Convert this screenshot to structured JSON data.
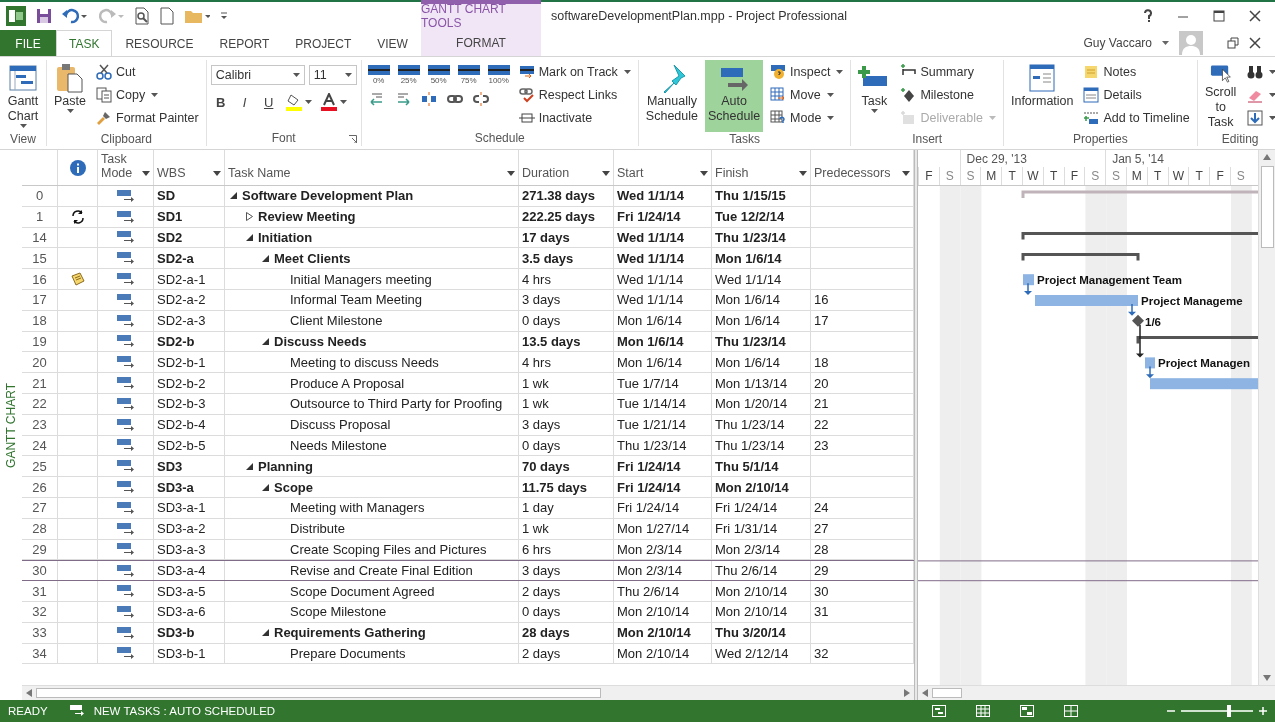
{
  "window": {
    "title": "softwareDevelopmentPlan.mpp - Project Professional",
    "context_group": "GANTT CHART TOOLS",
    "user": "Guy Vaccaro"
  },
  "ribbon_tabs": [
    {
      "label": "FILE",
      "kind": "file",
      "selected": false
    },
    {
      "label": "TASK",
      "kind": "tab",
      "selected": true
    },
    {
      "label": "RESOURCE",
      "kind": "tab",
      "selected": false
    },
    {
      "label": "REPORT",
      "kind": "tab",
      "selected": false
    },
    {
      "label": "PROJECT",
      "kind": "tab",
      "selected": false
    },
    {
      "label": "VIEW",
      "kind": "tab",
      "selected": false
    },
    {
      "label": "FORMAT",
      "kind": "context",
      "selected": false
    }
  ],
  "ribbon_groups": [
    {
      "label": "View",
      "items": [
        {
          "kind": "large",
          "label": "Gantt\nChart",
          "dropdown": true
        }
      ]
    },
    {
      "label": "Clipboard",
      "items": [
        {
          "kind": "large",
          "label": "Paste",
          "dropdown": true
        },
        {
          "kind": "small",
          "label": "Cut"
        },
        {
          "kind": "small",
          "label": "Copy",
          "dropdown": true
        },
        {
          "kind": "small",
          "label": "Format Painter"
        }
      ]
    },
    {
      "label": "Font",
      "launcher": true,
      "items": [
        {
          "kind": "font_face",
          "value": "Calibri"
        },
        {
          "kind": "font_size",
          "value": "11"
        },
        {
          "kind": "format",
          "label": "B"
        },
        {
          "kind": "format",
          "label": "I"
        },
        {
          "kind": "format",
          "label": "U"
        },
        {
          "kind": "color",
          "color": "#ffff00"
        },
        {
          "kind": "color",
          "color": "#e81123"
        }
      ]
    },
    {
      "label": "Schedule",
      "items": [
        {
          "kind": "percent",
          "label": "0%"
        },
        {
          "kind": "percent",
          "label": "25%"
        },
        {
          "kind": "percent",
          "label": "50%"
        },
        {
          "kind": "percent",
          "label": "75%"
        },
        {
          "kind": "percent",
          "label": "100%"
        },
        {
          "kind": "tool"
        },
        {
          "kind": "tool"
        },
        {
          "kind": "tool"
        },
        {
          "kind": "tool"
        },
        {
          "kind": "tool"
        },
        {
          "kind": "small",
          "label": "Mark on Track",
          "dropdown": true
        },
        {
          "kind": "small",
          "label": "Respect Links"
        },
        {
          "kind": "small",
          "label": "Inactivate"
        }
      ]
    },
    {
      "label": "Tasks",
      "items": [
        {
          "kind": "large",
          "label": "Manually\nSchedule",
          "selected": false
        },
        {
          "kind": "large",
          "label": "Auto\nSchedule",
          "selected": true
        },
        {
          "kind": "small",
          "label": "Inspect",
          "dropdown": true
        },
        {
          "kind": "small",
          "label": "Move",
          "dropdown": true
        },
        {
          "kind": "small",
          "label": "Mode",
          "dropdown": true
        }
      ]
    },
    {
      "label": "Insert",
      "items": [
        {
          "kind": "large",
          "label": "Task",
          "dropdown": true
        },
        {
          "kind": "small",
          "label": "Summary"
        },
        {
          "kind": "small",
          "label": "Milestone"
        },
        {
          "kind": "small",
          "label": "Deliverable",
          "dropdown": true,
          "disabled": true
        }
      ]
    },
    {
      "label": "Properties",
      "items": [
        {
          "kind": "large",
          "label": "Information"
        },
        {
          "kind": "small",
          "label": "Notes"
        },
        {
          "kind": "small",
          "label": "Details"
        },
        {
          "kind": "small",
          "label": "Add to Timeline"
        }
      ]
    },
    {
      "label": "Editing",
      "items": [
        {
          "kind": "large",
          "label": "Scroll\nto Task"
        },
        {
          "kind": "small",
          "dropdown": true
        },
        {
          "kind": "small",
          "dropdown": true
        },
        {
          "kind": "small",
          "dropdown": true
        }
      ]
    }
  ],
  "view_label": "GANTT CHART",
  "columns": [
    {
      "label": "Task\nMode",
      "filter": true
    },
    {
      "label": "WBS",
      "filter": true
    },
    {
      "label": "Task Name",
      "filter": true
    },
    {
      "label": "Duration",
      "filter": true
    },
    {
      "label": "Start",
      "filter": true
    },
    {
      "label": "Finish",
      "filter": true
    },
    {
      "label": "Predecessors",
      "filter": true
    }
  ],
  "tasks": [
    {
      "row_number": "0",
      "wbs": "SD",
      "name": "Software Development Plan",
      "duration": "271.38 days",
      "start": "Wed 1/1/14",
      "finish": "Thu 1/15/15",
      "kind": "summary",
      "expanded": true,
      "selected": false,
      "children": [
        {
          "row_number": "1",
          "recurring": true,
          "wbs": "SD1",
          "name": "Review Meeting",
          "duration": "222.25 days",
          "start": "Fri 1/24/14",
          "finish": "Tue 12/2/14",
          "kind": "summary",
          "expanded": false,
          "selected": false
        },
        {
          "row_number": "14",
          "wbs": "SD2",
          "name": "Initiation",
          "duration": "17 days",
          "start": "Wed 1/1/14",
          "finish": "Thu 1/23/14",
          "kind": "summary",
          "expanded": true,
          "selected": false,
          "children": [
            {
              "row_number": "15",
              "wbs": "SD2-a",
              "name": "Meet Clients",
              "duration": "3.5 days",
              "start": "Wed 1/1/14",
              "finish": "Mon 1/6/14",
              "kind": "summary",
              "expanded": true,
              "selected": false,
              "children": [
                {
                  "row_number": "16",
                  "has_note": true,
                  "wbs": "SD2-a-1",
                  "name": "Initial Managers meeting",
                  "duration": "4 hrs",
                  "start": "Wed 1/1/14",
                  "finish": "Wed 1/1/14",
                  "kind": "task",
                  "selected": false,
                  "bar_label": "Project Management Team"
                },
                {
                  "row_number": "17",
                  "wbs": "SD2-a-2",
                  "name": "Informal Team Meeting",
                  "duration": "3 days",
                  "start": "Wed 1/1/14",
                  "finish": "Mon 1/6/14",
                  "predecessors": "16",
                  "kind": "task",
                  "selected": false,
                  "bar_label": "Project Manageme"
                },
                {
                  "row_number": "18",
                  "wbs": "SD2-a-3",
                  "name": "Client Milestone",
                  "duration": "0 days",
                  "start": "Mon 1/6/14",
                  "finish": "Mon 1/6/14",
                  "predecessors": "17",
                  "kind": "milestone",
                  "selected": false,
                  "bar_label": "1/6"
                }
              ]
            },
            {
              "row_number": "19",
              "wbs": "SD2-b",
              "name": "Discuss Needs",
              "duration": "13.5 days",
              "start": "Mon 1/6/14",
              "finish": "Thu 1/23/14",
              "kind": "summary",
              "expanded": true,
              "selected": false,
              "children": [
                {
                  "row_number": "20",
                  "wbs": "SD2-b-1",
                  "name": "Meeting to discuss Needs",
                  "duration": "4 hrs",
                  "start": "Mon 1/6/14",
                  "finish": "Mon 1/6/14",
                  "predecessors": "18",
                  "kind": "task",
                  "selected": false,
                  "bar_label": "Project Managen"
                },
                {
                  "row_number": "21",
                  "wbs": "SD2-b-2",
                  "name": "Produce A Proposal",
                  "duration": "1 wk",
                  "start": "Tue 1/7/14",
                  "finish": "Mon 1/13/14",
                  "predecessors": "20",
                  "kind": "task",
                  "selected": false
                },
                {
                  "row_number": "22",
                  "wbs": "SD2-b-3",
                  "name": "Outsource to Third Party for Proofing",
                  "duration": "1 wk",
                  "start": "Tue 1/14/14",
                  "finish": "Mon 1/20/14",
                  "predecessors": "21",
                  "kind": "task",
                  "selected": false
                },
                {
                  "row_number": "23",
                  "wbs": "SD2-b-4",
                  "name": "Discuss Proposal",
                  "duration": "3 days",
                  "start": "Tue 1/21/14",
                  "finish": "Thu 1/23/14",
                  "predecessors": "22",
                  "kind": "task",
                  "selected": false
                },
                {
                  "row_number": "24",
                  "wbs": "SD2-b-5",
                  "name": "Needs Milestone",
                  "duration": "0 days",
                  "start": "Thu 1/23/14",
                  "finish": "Thu 1/23/14",
                  "predecessors": "23",
                  "kind": "milestone",
                  "selected": false
                }
              ]
            }
          ]
        },
        {
          "row_number": "25",
          "wbs": "SD3",
          "name": "Planning",
          "duration": "70 days",
          "start": "Fri 1/24/14",
          "finish": "Thu 5/1/14",
          "kind": "summary",
          "expanded": true,
          "selected": false,
          "children": [
            {
              "row_number": "26",
              "wbs": "SD3-a",
              "name": "Scope",
              "duration": "11.75 days",
              "start": "Fri 1/24/14",
              "finish": "Mon 2/10/14",
              "kind": "summary",
              "expanded": true,
              "selected": false,
              "children": [
                {
                  "row_number": "27",
                  "wbs": "SD3-a-1",
                  "name": "Meeting with Managers",
                  "duration": "1 day",
                  "start": "Fri 1/24/14",
                  "finish": "Fri 1/24/14",
                  "predecessors": "24",
                  "kind": "task",
                  "selected": false
                },
                {
                  "row_number": "28",
                  "wbs": "SD3-a-2",
                  "name": "Distribute",
                  "duration": "1 wk",
                  "start": "Mon 1/27/14",
                  "finish": "Fri 1/31/14",
                  "predecessors": "27",
                  "kind": "task",
                  "selected": false
                },
                {
                  "row_number": "29",
                  "wbs": "SD3-a-3",
                  "name": "Create Scoping Files and Pictures",
                  "duration": "6 hrs",
                  "start": "Mon 2/3/14",
                  "finish": "Mon 2/3/14",
                  "predecessors": "28",
                  "kind": "task",
                  "selected": false
                },
                {
                  "row_number": "30",
                  "wbs": "SD3-a-4",
                  "name": "Revise and Create Final Edition",
                  "duration": "3 days",
                  "start": "Mon 2/3/14",
                  "finish": "Thu 2/6/14",
                  "predecessors": "29",
                  "kind": "task",
                  "selected": true
                },
                {
                  "row_number": "31",
                  "wbs": "SD3-a-5",
                  "name": "Scope Document Agreed",
                  "duration": "2 days",
                  "start": "Thu 2/6/14",
                  "finish": "Mon 2/10/14",
                  "predecessors": "30",
                  "kind": "task",
                  "selected": false
                },
                {
                  "row_number": "32",
                  "wbs": "SD3-a-6",
                  "name": "Scope Milestone",
                  "duration": "0 days",
                  "start": "Mon 2/10/14",
                  "finish": "Mon 2/10/14",
                  "predecessors": "31",
                  "kind": "milestone",
                  "selected": false
                }
              ]
            },
            {
              "row_number": "33",
              "wbs": "SD3-b",
              "name": "Requirements Gathering",
              "duration": "28 days",
              "start": "Mon 2/10/14",
              "finish": "Thu 3/20/14",
              "kind": "summary",
              "expanded": true,
              "selected": false,
              "children": [
                {
                  "row_number": "34",
                  "wbs": "SD3-b-1",
                  "name": "Prepare Documents",
                  "duration": "2 days",
                  "start": "Mon 2/10/14",
                  "finish": "Wed 2/12/14",
                  "predecessors": "32",
                  "kind": "task",
                  "selected": false
                }
              ]
            }
          ]
        }
      ]
    }
  ],
  "timescale": {
    "weeks": [
      "Dec 29, '13",
      "Jan 5, '14"
    ],
    "days": [
      {
        "label": "F",
        "weekend": false
      },
      {
        "label": "S",
        "weekend": true
      },
      {
        "label": "S",
        "weekend": true
      },
      {
        "label": "M",
        "weekend": false
      },
      {
        "label": "T",
        "weekend": false
      },
      {
        "label": "W",
        "weekend": false
      },
      {
        "label": "T",
        "weekend": false
      },
      {
        "label": "F",
        "weekend": false
      },
      {
        "label": "S",
        "weekend": true
      },
      {
        "label": "S",
        "weekend": true
      },
      {
        "label": "M",
        "weekend": false
      },
      {
        "label": "T",
        "weekend": false
      },
      {
        "label": "W",
        "weekend": false
      },
      {
        "label": "T",
        "weekend": false
      },
      {
        "label": "F",
        "weekend": false
      },
      {
        "label": "S",
        "weekend": true
      }
    ]
  },
  "status_bar": {
    "ready": "READY",
    "new_tasks": "NEW TASKS : AUTO SCHEDULED",
    "zoom": {
      "level": 0.66
    }
  }
}
